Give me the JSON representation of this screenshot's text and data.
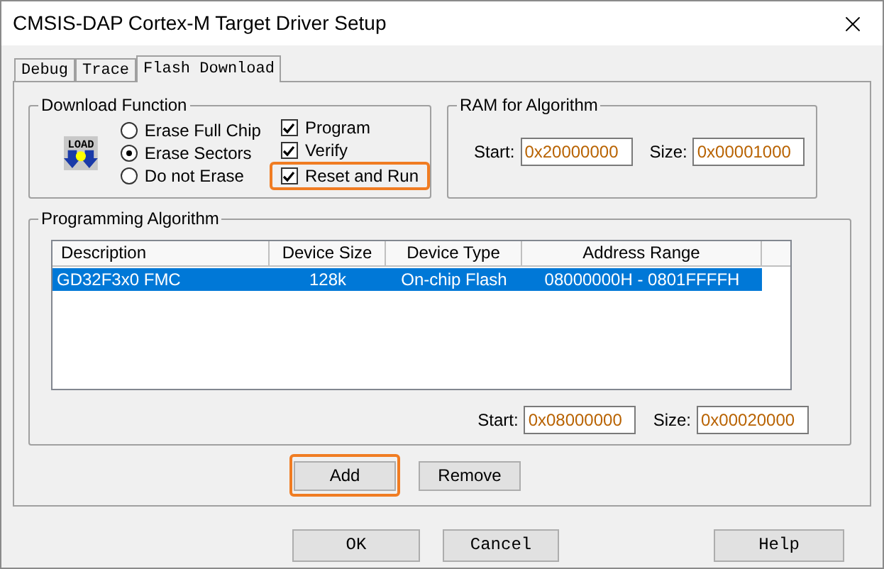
{
  "window": {
    "title": "CMSIS-DAP Cortex-M Target Driver Setup"
  },
  "tabs": [
    {
      "label": "Debug",
      "selected": false
    },
    {
      "label": "Trace",
      "selected": false
    },
    {
      "label": "Flash Download",
      "selected": true
    }
  ],
  "download_function": {
    "title": "Download Function",
    "icon_text": "LOAD",
    "erase_options": [
      {
        "label": "Erase Full Chip",
        "selected": false
      },
      {
        "label": "Erase Sectors",
        "selected": true
      },
      {
        "label": "Do not Erase",
        "selected": false
      }
    ],
    "checks": [
      {
        "label": "Program",
        "checked": true,
        "highlighted": false
      },
      {
        "label": "Verify",
        "checked": true,
        "highlighted": false
      },
      {
        "label": "Reset and Run",
        "checked": true,
        "highlighted": true
      }
    ]
  },
  "ram_for_algorithm": {
    "title": "RAM for Algorithm",
    "start_label": "Start:",
    "start": "0x20000000",
    "size_label": "Size:",
    "size": "0x00001000"
  },
  "programming_algorithm": {
    "title": "Programming Algorithm",
    "columns": [
      "Description",
      "Device Size",
      "Device Type",
      "Address Range"
    ],
    "rows": [
      {
        "cells": [
          "GD32F3x0 FMC",
          "128k",
          "On-chip Flash",
          "08000000H - 0801FFFFH"
        ],
        "selected": true
      }
    ],
    "start_label": "Start:",
    "start": "0x08000000",
    "size_label": "Size:",
    "size": "0x00020000"
  },
  "algorithm_buttons": [
    {
      "label": "Add",
      "highlighted": true
    },
    {
      "label": "Remove",
      "highlighted": false
    }
  ],
  "dialog_buttons": [
    {
      "label": "OK"
    },
    {
      "label": "Cancel"
    },
    {
      "label": "Help"
    }
  ]
}
